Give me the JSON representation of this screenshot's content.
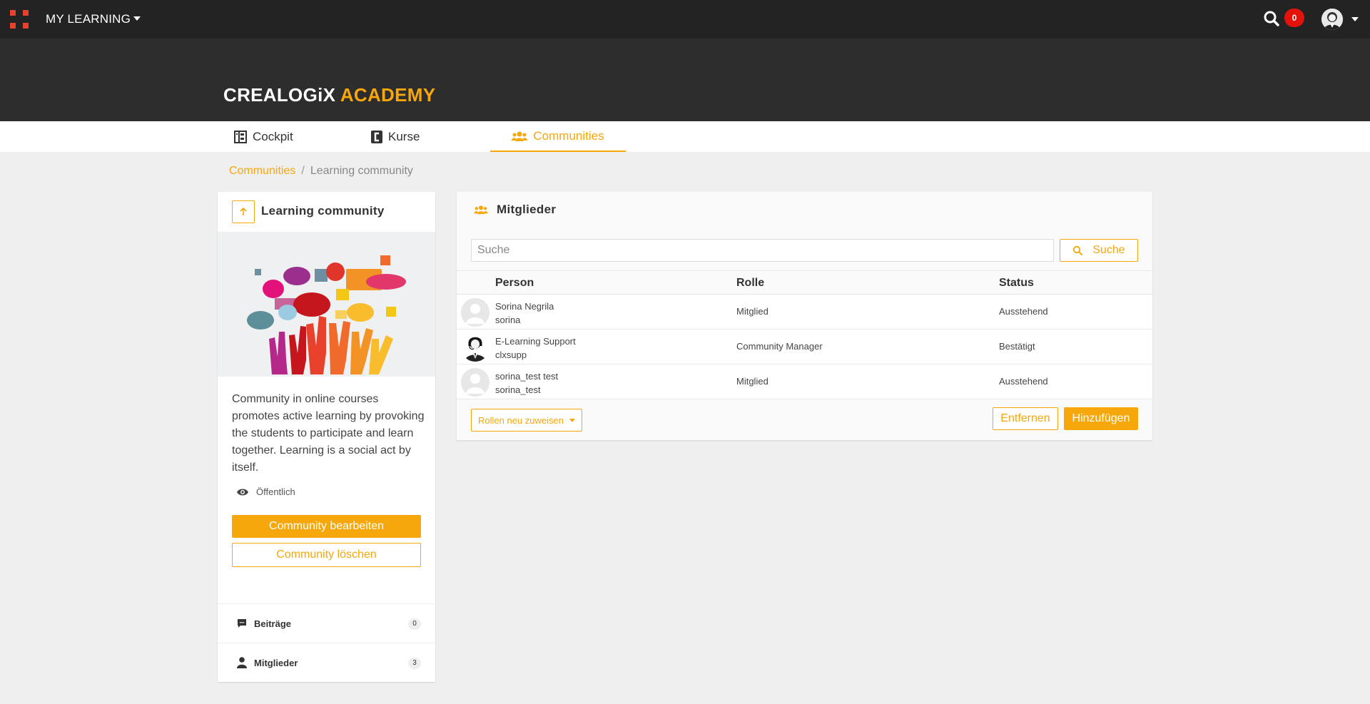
{
  "topbar": {
    "title": "MY LEARNING",
    "notification_count": "0",
    "icons": [
      "apps-grid-icon",
      "search-icon",
      "user-avatar-icon"
    ]
  },
  "brand": {
    "part1": "CREALOGiX",
    "part2": "ACADEMY"
  },
  "tabs": [
    {
      "label": "Cockpit",
      "icon": "cockpit-icon"
    },
    {
      "label": "Kurse",
      "icon": "courses-icon"
    },
    {
      "label": "Communities",
      "icon": "communities-icon",
      "active": true
    }
  ],
  "breadcrumb": {
    "link": "Communities",
    "separator": "/",
    "current": "Learning community"
  },
  "community": {
    "title": "Learning community",
    "description": "Community in online courses promotes active learning by provoking the students to participate and learn together. Learning is a social act by itself.",
    "visibility": "Öffentlich",
    "edit_label": "Community bearbeiten",
    "delete_label": "Community löschen",
    "sidebar": [
      {
        "label": "Beiträge",
        "count": "0",
        "icon": "comment-icon"
      },
      {
        "label": "Mitglieder",
        "count": "3",
        "icon": "person-icon"
      }
    ]
  },
  "members": {
    "title": "Mitglieder",
    "search_placeholder": "Suche",
    "search_button": "Suche",
    "columns": [
      "Person",
      "Rolle",
      "Status"
    ],
    "rows": [
      {
        "name": "Sorina Negrila",
        "username": "sorina",
        "role": "Mitglied",
        "status": "Ausstehend",
        "avatar": "default-avatar-icon"
      },
      {
        "name": "E-Learning Support",
        "username": "clxsupp",
        "role": "Community Manager",
        "status": "Bestätigt",
        "avatar": "support-agent-icon"
      },
      {
        "name": "sorina_test test",
        "username": "sorina_test",
        "role": "Mitglied",
        "status": "Ausstehend",
        "avatar": "default-avatar-icon"
      }
    ],
    "reassign_label": "Rollen neu zuweisen",
    "remove_label": "Entfernen",
    "add_label": "Hinzufügen"
  },
  "colors": {
    "accent": "#f6a70b",
    "topbar": "#232323",
    "banner": "#2d2d2d",
    "badge": "#e3120b",
    "apps_icon": "#e8412c"
  }
}
